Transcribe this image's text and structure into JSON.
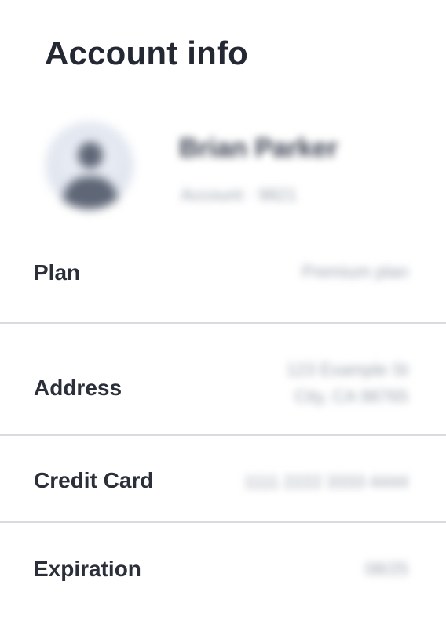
{
  "header": {
    "title": "Account info"
  },
  "profile": {
    "avatar_icon": "user-avatar-icon",
    "name": "Brian Parker",
    "account": "Account · 9821"
  },
  "rows": {
    "plan": {
      "label": "Plan",
      "value": "Premium plan"
    },
    "address": {
      "label": "Address",
      "value_line1": "123 Example St",
      "value_line2": "City, CA 98765"
    },
    "credit_card": {
      "label": "Credit Card",
      "value": "1111 2222 3333 4444"
    },
    "expiration": {
      "label": "Expiration",
      "value": "08/25"
    }
  },
  "colors": {
    "title": "#232833",
    "label": "#2b2f3a",
    "muted": "#9aa1ad",
    "divider": "#d9dbe0",
    "background": "#ffffff"
  }
}
